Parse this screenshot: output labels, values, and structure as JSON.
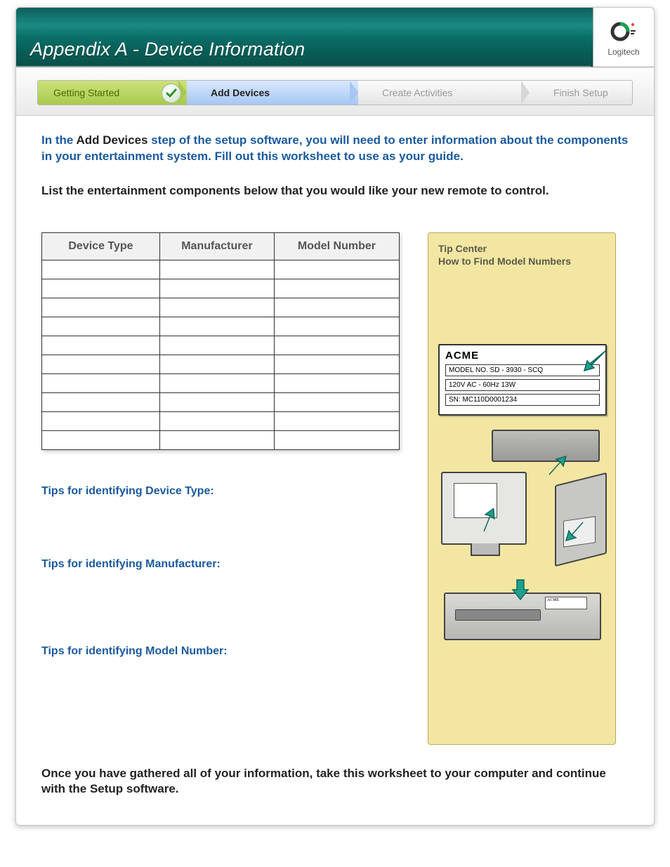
{
  "header": {
    "title": "Appendix A - Device Information"
  },
  "brand": {
    "name": "Logitech"
  },
  "steps": {
    "s1": "Getting Started",
    "s2": "Add Devices",
    "s3": "Create Activities",
    "s4": "Finish Setup"
  },
  "intro": {
    "pre": "In the ",
    "bold": "Add Devices",
    "post": " step of the setup software, you will need to enter information about the components in your entertainment system. Fill out this worksheet to use as your guide."
  },
  "list_instruction": "List the entertainment components below that you would like your new remote to control.",
  "table": {
    "headers": {
      "c1": "Device Type",
      "c2": "Manufacturer",
      "c3": "Model Number"
    },
    "row_count": 10
  },
  "tips": {
    "t1": "Tips for identifying Device Type:",
    "t2": "Tips for identifying Manufacturer:",
    "t3": "Tips for identifying Model Number:"
  },
  "tipbox": {
    "title": "Tip Center",
    "subtitle": "How to Find Model Numbers",
    "label": {
      "brand": "ACME",
      "line1": "MODEL NO. SD - 3930 - SCQ",
      "line2": "120V AC - 60Hz 13W",
      "line3": "SN: MC110D0001234",
      "vcr_brand": "ACME"
    }
  },
  "final": "Once you have gathered all of your information, take this worksheet to your computer and continue with the Setup software."
}
